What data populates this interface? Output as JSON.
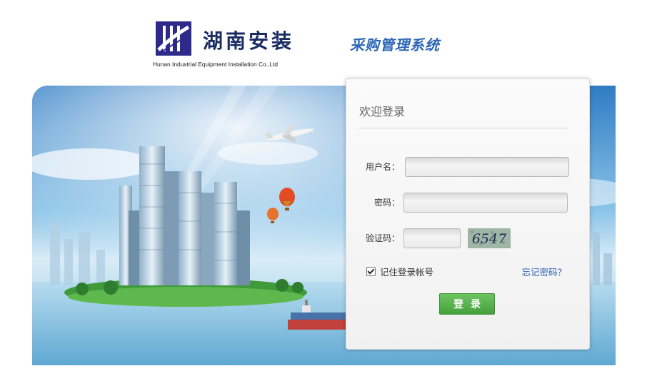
{
  "header": {
    "company_name": "湖南安装",
    "company_en": "Hunan Industrial Equipment Installation Co.,Ltd",
    "system_title": "采购管理系统"
  },
  "login": {
    "title": "欢迎登录",
    "username_label": "用户名：",
    "password_label": "密码：",
    "captcha_label": "验证码：",
    "captcha_text": "6547",
    "remember_label": "记住登录帐号",
    "forgot_label": "忘记密码？",
    "submit_label": "登录"
  },
  "colors": {
    "brand": "#1b2c63",
    "title_blue": "#2d66b6",
    "button_green": "#45a13c",
    "link_blue": "#2f5fb3"
  },
  "icons": {
    "logo": "company-logo-icon",
    "remember": "checkbox-checked-icon"
  }
}
